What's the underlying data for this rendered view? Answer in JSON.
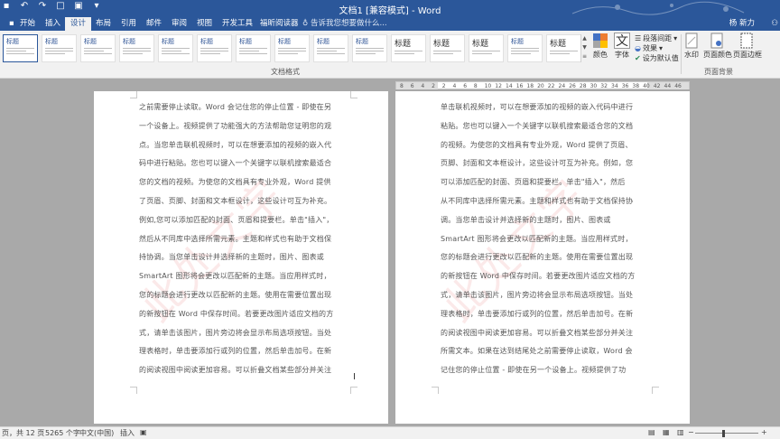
{
  "app": {
    "title": "文档1 [兼容模式] - Word",
    "user": "杨 新力",
    "share_label": "共享"
  },
  "tabs": [
    {
      "label": "开始"
    },
    {
      "label": "插入"
    },
    {
      "label": "设计"
    },
    {
      "label": "布局"
    },
    {
      "label": "引用"
    },
    {
      "label": "邮件"
    },
    {
      "label": "审阅"
    },
    {
      "label": "视图"
    },
    {
      "label": "开发工具"
    },
    {
      "label": "福昕阅读器"
    }
  ],
  "tell_me": "告诉我您想要做什么...",
  "ribbon": {
    "style_thumbs": [
      {
        "title": "标题"
      },
      {
        "title": "标题"
      },
      {
        "title": "标题"
      },
      {
        "title": "标题"
      },
      {
        "title": "标题"
      },
      {
        "title": "标题"
      },
      {
        "title": "标题"
      },
      {
        "title": "标题"
      },
      {
        "title": "标题"
      },
      {
        "title": "标题"
      },
      {
        "title": "标题"
      },
      {
        "title": "标题"
      },
      {
        "title": "标题"
      },
      {
        "title": "标题"
      },
      {
        "title": "标题"
      }
    ],
    "colors_label": "颜色",
    "fonts_label": "字体",
    "paragraph_spacing": "段落间距",
    "effects": "效果",
    "set_default": "设为默认值",
    "watermark": "水印",
    "page_color": "页面颜色",
    "page_border": "页面边框",
    "group_docformat": "文档格式",
    "group_background": "页面背景"
  },
  "ruler": {
    "ticks": [
      "8",
      "6",
      "4",
      "2",
      "2",
      "4",
      "6",
      "8",
      "10",
      "12",
      "14",
      "16",
      "18",
      "20",
      "22",
      "24",
      "26",
      "28",
      "30",
      "32",
      "34",
      "36",
      "38",
      "40",
      "42",
      "44",
      "46"
    ]
  },
  "watermark_text": "此处文字",
  "pages": [
    {
      "lines": [
        "之前需要停止读取。Word 会记住您的停止位置 - 即使在另",
        "一个设备上。视频提供了功能强大的方法帮助您证明您的观",
        "点。当您单击联机视频时，可以在想要添加的视频的嵌入代",
        "码中进行粘贴。您也可以键入一个关键字以联机搜索最适合",
        "您的文档的视频。为使您的文档具有专业外观，Word 提供",
        "了页眉、页脚、封面和文本框设计，这些设计可互为补充。",
        "例如,您可以添加匹配的封面、页眉和提要栏。单击\"插入\"，",
        "然后从不同库中选择所需元素。主题和样式也有助于文档保",
        "持协调。当您单击设计并选择新的主题时，图片、图表或",
        "SmartArt 图形将会更改以匹配新的主题。当应用样式时，",
        "您的标题会进行更改以匹配新的主题。使用在需要位置出现",
        "的新按钮在 Word 中保存时间。若要更改图片适应文档的方",
        "式，请单击该图片，图片旁边将会显示布局选项按钮。当处",
        "理表格时，单击要添加行或列的位置，然后单击加号。在新",
        "的阅读视图中阅读更加容易。可以折叠文档某些部分并关注"
      ]
    },
    {
      "lines": [
        "单击联机视频时，可以在想要添加的视频的嵌入代码中进行",
        "粘贴。您也可以键入一个关键字以联机搜索最适合您的文档",
        "的视频。为使您的文档具有专业外观，Word 提供了页眉、",
        "页脚、封面和文本框设计，这些设计可互为补充。例如，您",
        "可以添加匹配的封面、页眉和提要栏。单击\"插入\"，然后",
        "从不同库中选择所需元素。主题和样式也有助于文档保持协",
        "调。当您单击设计并选择新的主题时，图片、图表或",
        "SmartArt 图形将会更改以匹配新的主题。当应用样式时，",
        "您的标题会进行更改以匹配新的主题。使用在需要位置出现",
        "的新按钮在 Word 中保存时间。若要更改图片适应文档的方",
        "式，请单击该图片，图片旁边将会显示布局选项按钮。当处",
        "理表格时，单击要添加行或列的位置，然后单击加号。在新",
        "的阅读视图中阅读更加容易。可以折叠文档某些部分并关注",
        "所需文本。如果在达到结尾处之前需要停止读取，Word 会",
        "记住您的停止位置 - 即使在另一个设备上。视频提供了功"
      ]
    }
  ],
  "status": {
    "page_info": "页，共 12 页",
    "word_count": "5265 个字",
    "language": "中文(中国)",
    "mode": "插入"
  }
}
